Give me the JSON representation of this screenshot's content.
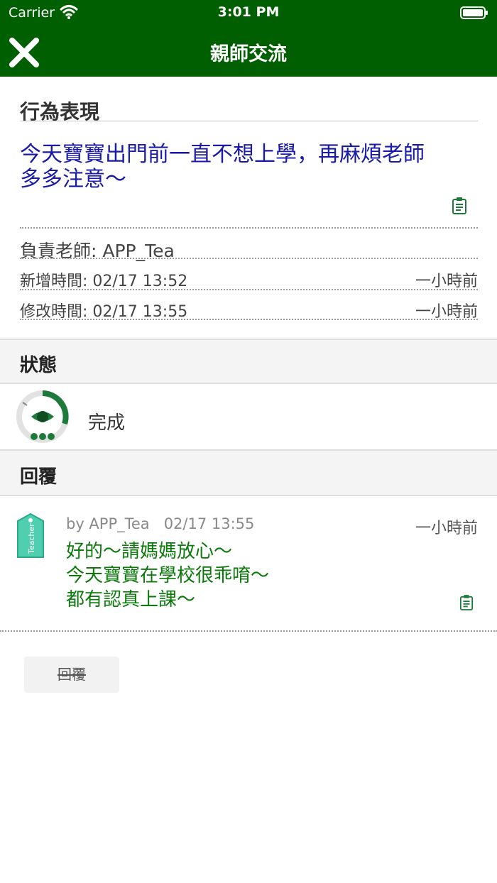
{
  "status_bar": {
    "carrier": "Carrier",
    "time": "3:01 PM"
  },
  "nav": {
    "title": "親師交流"
  },
  "behavior": {
    "heading": "行為表現",
    "message_line1": "今天寶寶出門前一直不想上學，再麻煩老師",
    "message_line2": "多多注意～",
    "teacher": "負責老師: APP_Tea",
    "created": "新增時間: 02/17 13:52",
    "created_ago": "一小時前",
    "modified": "修改時間: 02/17 13:55",
    "modified_ago": "一小時前"
  },
  "status": {
    "heading": "狀態",
    "value": "完成"
  },
  "replies": {
    "heading": "回覆",
    "items": [
      {
        "tag_label": "Teacher",
        "author": "by APP_Tea",
        "timestamp": "02/17 13:55",
        "ago": "一小時前",
        "line1": "好的～請媽媽放心～",
        "line2": "今天寶寶在學校很乖唷～",
        "line3": "都有認真上課～"
      }
    ],
    "button_label": "回覆"
  },
  "colors": {
    "nav_bg": "#005f00",
    "message": "#1a1aa8",
    "reply_text": "#0b7a0b",
    "accent_green": "#1e7a3a"
  },
  "icons": [
    "wifi-icon",
    "battery-icon",
    "close-icon",
    "clipboard-icon",
    "status-gauge-icon",
    "teacher-tag-icon"
  ]
}
